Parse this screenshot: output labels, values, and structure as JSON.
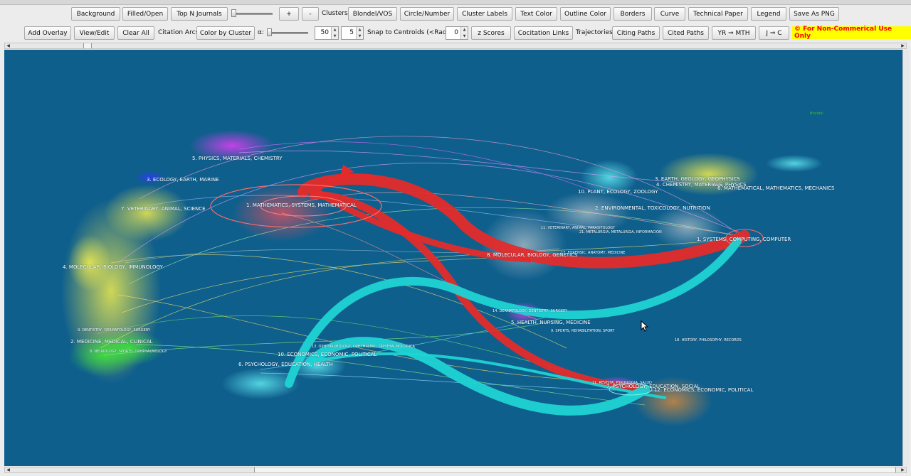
{
  "toolbar1": {
    "background": "Background",
    "filled_open": "Filled/Open",
    "top_n_journals": "Top N Journals",
    "plus": "+",
    "minus": "-",
    "clusters_label": "Clusters:",
    "blondel_vos": "Blondel/VOS",
    "circle_number": "Circle/Number",
    "cluster_labels": "Cluster Labels",
    "text_color": "Text Color",
    "outline_color": "Outline Color",
    "borders": "Borders",
    "curve": "Curve",
    "technical_paper": "Technical Paper",
    "legend": "Legend",
    "save_as_png": "Save As PNG"
  },
  "toolbar2": {
    "add_overlay": "Add Overlay",
    "view_edit": "View/Edit",
    "clear_all": "Clear All",
    "citation_arcs_label": "Citation Arcs:",
    "color_by_cluster": "Color by Cluster",
    "alpha_label": "α:",
    "spin1_value": "50",
    "spin2_value": "5",
    "snap_label": "Snap to Centroids (<Radius):",
    "snap_value": "0",
    "z_scores": "z Scores",
    "cocitation_links": "Cocitation Links",
    "trajectories_label": "Trajectories:",
    "citing_paths": "Citing Paths",
    "cited_paths": "Cited Paths",
    "yr_mth": "YR ⇒ MTH",
    "j_c": "J ⇒ C",
    "notice": "© For Non-Commerical Use Only"
  },
  "map": {
    "background_color": "#0f5f8d",
    "corner_tag": "Blondel",
    "left_clusters": [
      {
        "name": "5. PHYSICS, MATERIALS, CHEMISTRY"
      },
      {
        "name": "3. ECOLOGY, EARTH, MARINE"
      },
      {
        "name": "7. VETERINARY, ANIMAL, SCIENCE"
      },
      {
        "name": "1. MATHEMATICS, SYSTEMS, MATHEMATICAL"
      },
      {
        "name": "4. MOLECULAR, BIOLOGY, IMMUNOLOGY"
      },
      {
        "name": "9. DENTISTRY, DERMATOLOGY, SURGERY"
      },
      {
        "name": "2. MEDICINE, MEDICAL, CLINICAL"
      },
      {
        "name": "8. NEUROLOGY, SPORTS, OPHTHALMOLOGY"
      },
      {
        "name": "10. ECONOMICS, ECONOMIC, POLITICAL"
      },
      {
        "name": "6. PSYCHOLOGY, EDUCATION, HEALTH"
      }
    ],
    "right_clusters": [
      {
        "name": "3. EARTH, GEOLOGY, GEOPHYSICS"
      },
      {
        "name": "4. CHEMISTRY, MATERIALS, PHYSICS"
      },
      {
        "name": "6. MATHEMATICAL, MATHEMATICS, MECHANICS"
      },
      {
        "name": "10. PLANT, ECOLOGY, ZOOLOGY"
      },
      {
        "name": "2. ENVIRONMENTAL, TOXICOLOGY, NUTRITION"
      },
      {
        "name": "11. VETERINARY, ANIMAL, PARASITOLOGY"
      },
      {
        "name": "21. METALURGIA, METALURGIA, INFORMACION"
      },
      {
        "name": "1. SYSTEMS, COMPUTING, COMPUTER"
      },
      {
        "name": "17. FORENSIC, ANATOMY, MEDICINE"
      },
      {
        "name": "8. MOLECULAR, BIOLOGY, GENETICS"
      },
      {
        "name": "14. DERMATOLOGY, DENTISTRY, SURGERY"
      },
      {
        "name": "5. HEALTH, NURSING, MEDICINE"
      },
      {
        "name": "9. SPORTS, REHABILITATION, SPORT"
      },
      {
        "name": "18. HISTORY, PHILOSOPHY, RECORDS"
      },
      {
        "name": "11. REVISTA, PSICOLOGIA, SALUD"
      },
      {
        "name": "7. PSYCHOLOGY, EDUCATION, SOCIAL"
      },
      {
        "name": "12. ECONOMICS, ECONOMIC, POLITICAL"
      },
      {
        "name": "13. OPHTHALMOLOGY, OPHTHALMIC, OPHTHALMOLOGICA"
      }
    ],
    "arc_colors": {
      "mathematics": "#e42b2b",
      "psychology": "#1fd3d3"
    }
  }
}
